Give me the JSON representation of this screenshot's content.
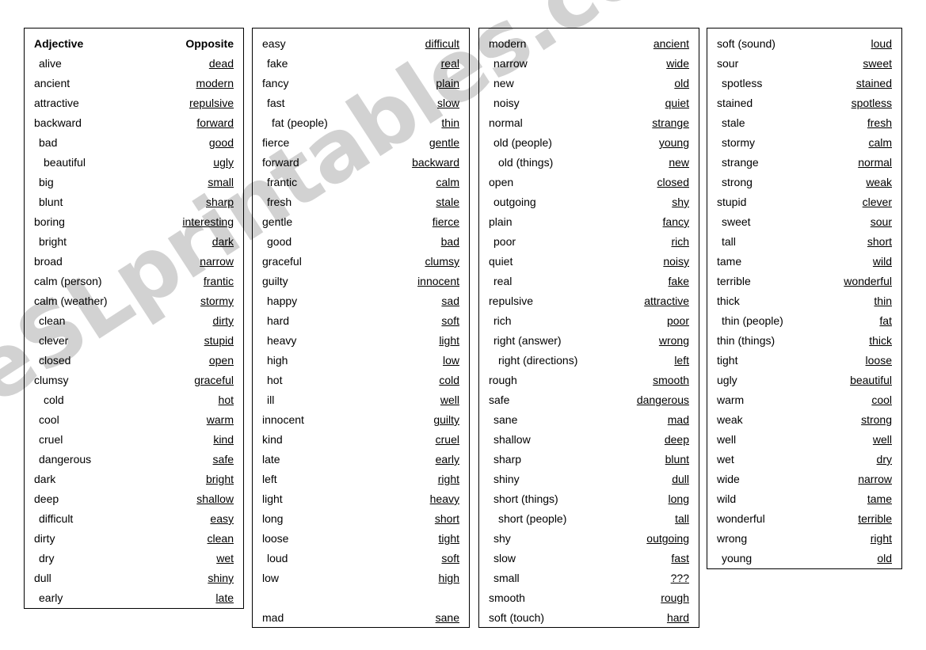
{
  "watermark": {
    "text": "eSLprintables.com"
  },
  "colors": {
    "text": "#000000",
    "border": "#000000",
    "watermark": "#d2d2d2",
    "background": "#ffffff"
  },
  "columns": [
    {
      "id": "column-1",
      "header": {
        "left": "Adjective",
        "right": "Opposite"
      },
      "rows": [
        {
          "left": "alive",
          "right": "dead",
          "indent": 1
        },
        {
          "left": "ancient",
          "right": "modern",
          "indent": 0
        },
        {
          "left": "attractive",
          "right": "repulsive",
          "indent": 0
        },
        {
          "left": "backward",
          "right": "forward",
          "indent": 0
        },
        {
          "left": "bad",
          "right": "good",
          "indent": 1
        },
        {
          "left": "beautiful",
          "right": "ugly",
          "indent": 2
        },
        {
          "left": "big",
          "right": "small",
          "indent": 1
        },
        {
          "left": "blunt",
          "right": "sharp",
          "indent": 1
        },
        {
          "left": "boring",
          "right": "interesting",
          "indent": 0
        },
        {
          "left": "bright",
          "right": "dark",
          "indent": 1
        },
        {
          "left": "broad",
          "right": "narrow",
          "indent": 0
        },
        {
          "left": "calm (person)",
          "right": "frantic",
          "indent": 0
        },
        {
          "left": "calm (weather)",
          "right": "stormy",
          "indent": 0
        },
        {
          "left": "clean",
          "right": "dirty",
          "indent": 1
        },
        {
          "left": "clever",
          "right": "stupid",
          "indent": 1
        },
        {
          "left": "closed",
          "right": "open",
          "indent": 1
        },
        {
          "left": "clumsy",
          "right": "graceful",
          "indent": 0
        },
        {
          "left": "cold",
          "right": "hot",
          "indent": 2
        },
        {
          "left": "cool",
          "right": "warm",
          "indent": 1
        },
        {
          "left": "cruel",
          "right": "kind",
          "indent": 1
        },
        {
          "left": "dangerous",
          "right": "safe",
          "indent": 1
        },
        {
          "left": "dark",
          "right": "bright",
          "indent": 0
        },
        {
          "left": "deep",
          "right": "shallow",
          "indent": 0
        },
        {
          "left": "difficult",
          "right": "easy",
          "indent": 1
        },
        {
          "left": "dirty",
          "right": "clean",
          "indent": 0
        },
        {
          "left": "dry",
          "right": "wet",
          "indent": 1
        },
        {
          "left": "dull",
          "right": "shiny",
          "indent": 0
        },
        {
          "left": "early",
          "right": "late",
          "indent": 1
        }
      ]
    },
    {
      "id": "column-2",
      "header": null,
      "rows": [
        {
          "left": "easy",
          "right": "difficult",
          "indent": 0
        },
        {
          "left": "fake",
          "right": "real",
          "indent": 1
        },
        {
          "left": "fancy",
          "right": "plain",
          "indent": 0
        },
        {
          "left": "fast",
          "right": "slow",
          "indent": 1
        },
        {
          "left": "fat (people)",
          "right": "thin",
          "indent": 2
        },
        {
          "left": "fierce",
          "right": "gentle",
          "indent": 0
        },
        {
          "left": "forward",
          "right": "backward",
          "indent": 0
        },
        {
          "left": "frantic",
          "right": "calm",
          "indent": 1
        },
        {
          "left": "fresh",
          "right": "stale",
          "indent": 1
        },
        {
          "left": "gentle",
          "right": "fierce",
          "indent": 0
        },
        {
          "left": "good",
          "right": "bad",
          "indent": 1
        },
        {
          "left": "graceful",
          "right": "clumsy",
          "indent": 0
        },
        {
          "left": "guilty",
          "right": "innocent",
          "indent": 0
        },
        {
          "left": "happy",
          "right": "sad",
          "indent": 1
        },
        {
          "left": "hard",
          "right": "soft",
          "indent": 1
        },
        {
          "left": "heavy",
          "right": "light",
          "indent": 1
        },
        {
          "left": "high",
          "right": "low",
          "indent": 1
        },
        {
          "left": "hot",
          "right": "cold",
          "indent": 1
        },
        {
          "left": "ill",
          "right": "well",
          "indent": 1
        },
        {
          "left": "innocent",
          "right": "guilty",
          "indent": 0
        },
        {
          "left": "kind",
          "right": "cruel",
          "indent": 0
        },
        {
          "left": "late",
          "right": "early",
          "indent": 0
        },
        {
          "left": "left",
          "right": "right",
          "indent": 0
        },
        {
          "left": "light",
          "right": "heavy",
          "indent": 0
        },
        {
          "left": "long",
          "right": "short",
          "indent": 0
        },
        {
          "left": "loose",
          "right": "tight",
          "indent": 0
        },
        {
          "left": "loud",
          "right": "soft",
          "indent": 1
        },
        {
          "left": "low",
          "right": "high",
          "indent": 0
        },
        {
          "spacer": true
        },
        {
          "left": "mad",
          "right": "sane",
          "indent": 0
        }
      ]
    },
    {
      "id": "column-3",
      "header": null,
      "rows": [
        {
          "left": "modern",
          "right": "ancient",
          "indent": 0
        },
        {
          "left": "narrow",
          "right": "wide",
          "indent": 1
        },
        {
          "left": "new",
          "right": "old",
          "indent": 1
        },
        {
          "left": "noisy",
          "right": "quiet",
          "indent": 1
        },
        {
          "left": "normal",
          "right": "strange",
          "indent": 0
        },
        {
          "left": "old (people)",
          "right": "young",
          "indent": 1
        },
        {
          "left": "old (things)",
          "right": "new",
          "indent": 2
        },
        {
          "left": "open",
          "right": "closed",
          "indent": 0
        },
        {
          "left": "outgoing",
          "right": "shy",
          "indent": 1
        },
        {
          "left": "plain",
          "right": "fancy",
          "indent": 0
        },
        {
          "left": "poor",
          "right": "rich",
          "indent": 1
        },
        {
          "left": "quiet",
          "right": "noisy",
          "indent": 0
        },
        {
          "left": "real",
          "right": "fake",
          "indent": 1
        },
        {
          "left": "repulsive",
          "right": "attractive",
          "indent": 0
        },
        {
          "left": "rich",
          "right": "poor",
          "indent": 1
        },
        {
          "left": "right (answer)",
          "right": "wrong",
          "indent": 1
        },
        {
          "left": "right (directions)",
          "right": "left",
          "indent": 2
        },
        {
          "left": "rough",
          "right": "smooth",
          "indent": 0
        },
        {
          "left": "safe",
          "right": "dangerous",
          "indent": 0
        },
        {
          "left": "sane",
          "right": "mad",
          "indent": 1
        },
        {
          "left": "shallow",
          "right": "deep",
          "indent": 1
        },
        {
          "left": "sharp",
          "right": "blunt",
          "indent": 1
        },
        {
          "left": "shiny",
          "right": "dull",
          "indent": 1
        },
        {
          "left": "short (things)",
          "right": "long",
          "indent": 1
        },
        {
          "left": "short (people)",
          "right": "tall",
          "indent": 2
        },
        {
          "left": "shy",
          "right": "outgoing",
          "indent": 1
        },
        {
          "left": "slow",
          "right": "fast",
          "indent": 1
        },
        {
          "left": "small",
          "right": "???",
          "indent": 1
        },
        {
          "left": "smooth",
          "right": "rough",
          "indent": 0
        },
        {
          "left": "soft (touch)",
          "right": "hard",
          "indent": 0
        }
      ]
    },
    {
      "id": "column-4",
      "header": null,
      "rows": [
        {
          "left": "soft (sound)",
          "right": "loud",
          "indent": 0
        },
        {
          "left": "sour",
          "right": "sweet",
          "indent": 0
        },
        {
          "left": "spotless",
          "right": "stained",
          "indent": 1
        },
        {
          "left": "stained",
          "right": "spotless",
          "indent": 0
        },
        {
          "left": "stale",
          "right": "fresh",
          "indent": 1
        },
        {
          "left": "stormy",
          "right": "calm",
          "indent": 1
        },
        {
          "left": "strange",
          "right": "normal",
          "indent": 1
        },
        {
          "left": "strong",
          "right": "weak",
          "indent": 1
        },
        {
          "left": "stupid",
          "right": "clever",
          "indent": 0
        },
        {
          "left": "sweet",
          "right": "sour",
          "indent": 1
        },
        {
          "left": "tall",
          "right": "short",
          "indent": 1
        },
        {
          "left": "tame",
          "right": "wild",
          "indent": 0
        },
        {
          "left": "terrible",
          "right": "wonderful",
          "indent": 0
        },
        {
          "left": "thick",
          "right": "thin",
          "indent": 0
        },
        {
          "left": "thin (people)",
          "right": "fat",
          "indent": 1
        },
        {
          "left": "thin (things)",
          "right": "thick",
          "indent": 0
        },
        {
          "left": "tight",
          "right": "loose",
          "indent": 0
        },
        {
          "left": "ugly",
          "right": "beautiful",
          "indent": 0
        },
        {
          "left": "warm",
          "right": "cool",
          "indent": 0
        },
        {
          "left": "weak",
          "right": "strong",
          "indent": 0
        },
        {
          "left": "well",
          "right": "well",
          "indent": 0
        },
        {
          "left": "wet",
          "right": "dry",
          "indent": 0
        },
        {
          "left": "wide",
          "right": "narrow",
          "indent": 0
        },
        {
          "left": "wild",
          "right": "tame",
          "indent": 0
        },
        {
          "left": "wonderful",
          "right": "terrible",
          "indent": 0
        },
        {
          "left": "wrong",
          "right": "right",
          "indent": 0
        },
        {
          "left": "young",
          "right": "old",
          "indent": 1
        }
      ]
    }
  ]
}
